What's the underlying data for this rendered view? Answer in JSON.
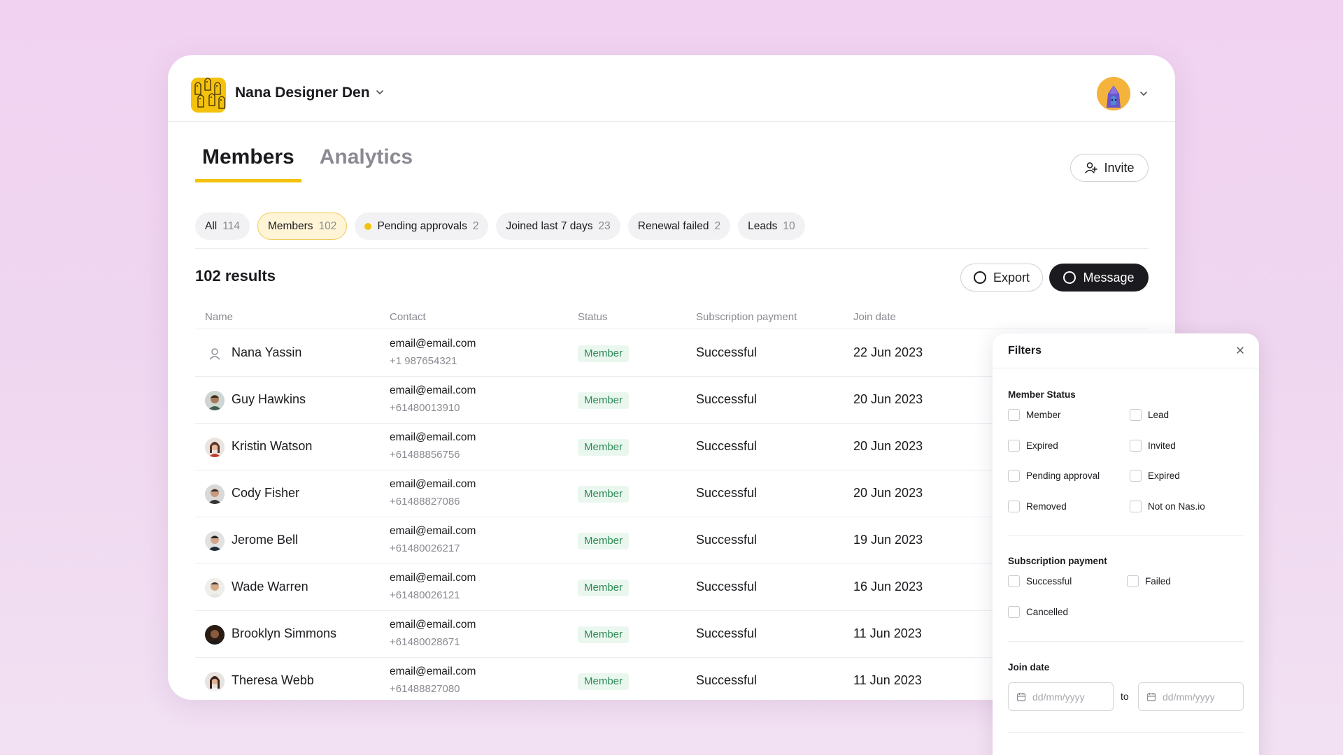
{
  "org": {
    "name": "Nana Designer Den"
  },
  "tabs": [
    {
      "label": "Members",
      "active": true
    },
    {
      "label": "Analytics",
      "active": false
    }
  ],
  "invite_label": "Invite",
  "chips": [
    {
      "label": "All",
      "count": "114"
    },
    {
      "label": "Members",
      "count": "102",
      "active": true
    },
    {
      "label": "Pending approvals",
      "count": "2",
      "dot": true
    },
    {
      "label": "Joined last 7 days",
      "count": "23"
    },
    {
      "label": "Renewal failed",
      "count": "2"
    },
    {
      "label": "Leads",
      "count": "10"
    }
  ],
  "results_label": "102 results",
  "actions": {
    "export": "Export",
    "message": "Message"
  },
  "table": {
    "headers": [
      "Name",
      "Contact",
      "Status",
      "Subscription payment",
      "Join date"
    ],
    "rows": [
      {
        "name": "Nana Yassin",
        "email": "email@email.com",
        "phone": "+1 987654321",
        "status": "Member",
        "payment": "Successful",
        "date": "22 Jun 2023",
        "avatar": "person-placeholder-icon"
      },
      {
        "name": "Guy Hawkins",
        "email": "email@email.com",
        "phone": "+61480013910",
        "status": "Member",
        "payment": "Successful",
        "date": "20 Jun 2023",
        "avatar": "photo"
      },
      {
        "name": "Kristin Watson",
        "email": "email@email.com",
        "phone": "+61488856756",
        "status": "Member",
        "payment": "Successful",
        "date": "20 Jun 2023",
        "avatar": "photo"
      },
      {
        "name": "Cody Fisher",
        "email": "email@email.com",
        "phone": "+61488827086",
        "status": "Member",
        "payment": "Successful",
        "date": "20 Jun 2023",
        "avatar": "photo"
      },
      {
        "name": "Jerome Bell",
        "email": "email@email.com",
        "phone": "+61480026217",
        "status": "Member",
        "payment": "Successful",
        "date": "19 Jun 2023",
        "avatar": "photo"
      },
      {
        "name": "Wade Warren",
        "email": "email@email.com",
        "phone": "+61480026121",
        "status": "Member",
        "payment": "Successful",
        "date": "16 Jun 2023",
        "avatar": "photo"
      },
      {
        "name": "Brooklyn Simmons",
        "email": "email@email.com",
        "phone": "+61480028671",
        "status": "Member",
        "payment": "Successful",
        "date": "11 Jun 2023",
        "avatar": "photo"
      },
      {
        "name": "Theresa Webb",
        "email": "email@email.com",
        "phone": "+61488827080",
        "status": "Member",
        "payment": "Successful",
        "date": "11 Jun 2023",
        "avatar": "photo"
      }
    ]
  },
  "filters": {
    "title": "Filters",
    "member_status": {
      "title": "Member Status",
      "options": [
        "Member",
        "Lead",
        "Expired",
        "Invited",
        "Pending approval",
        "Expired",
        "Removed",
        "Not on Nas.io"
      ]
    },
    "subscription_payment": {
      "title": "Subscription payment",
      "options": [
        "Successful",
        "Failed",
        "Cancelled"
      ]
    },
    "join_date": {
      "title": "Join date",
      "from_placeholder": "dd/mm/yyyy",
      "to_label": "to",
      "to_placeholder": "dd/mm/yyyy"
    }
  },
  "colors": {
    "accent": "#f4c20d",
    "badge_bg": "#eaf7ef",
    "badge_text": "#2f8a57",
    "dark_button": "#1b1b1f"
  }
}
